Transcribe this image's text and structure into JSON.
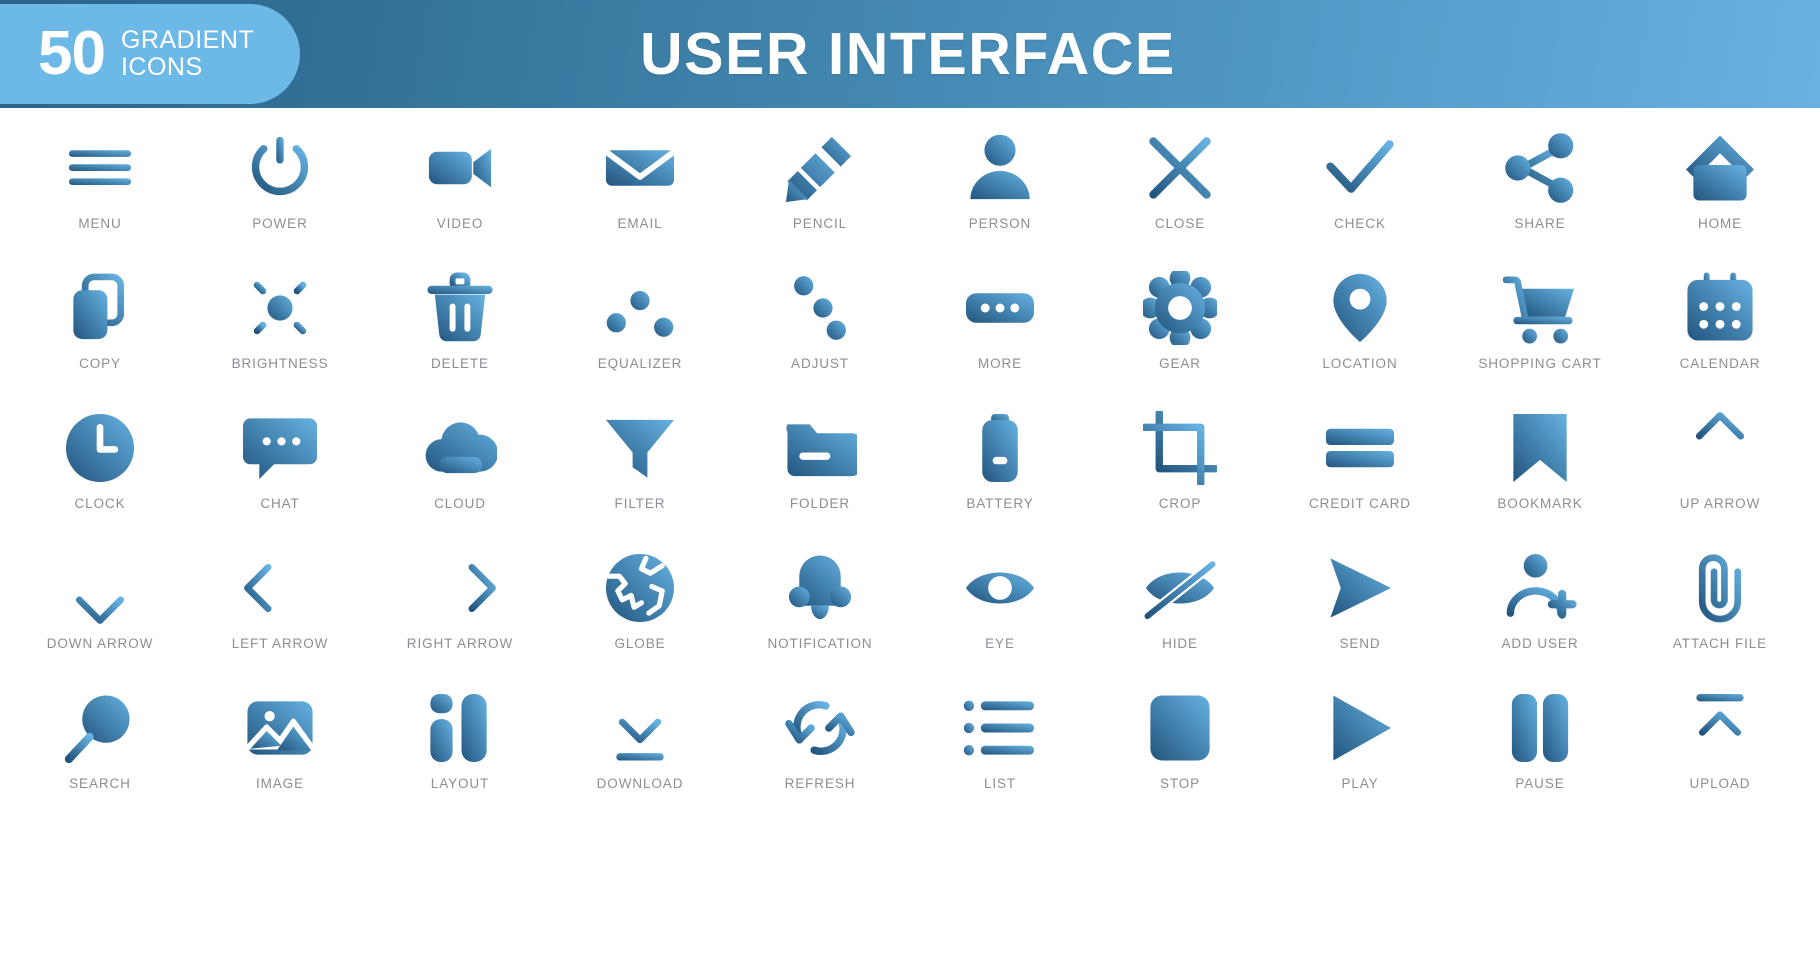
{
  "header": {
    "badge_number": "50",
    "badge_line1": "GRADIENT",
    "badge_line2": "ICONS",
    "title": "USER INTERFACE",
    "badge_color": "#6cb9e8",
    "gradient_start": "#2d6489",
    "gradient_end": "#68b2e0",
    "title_color": "#ffffff"
  },
  "style": {
    "icon_gradient_dark": "#22557e",
    "icon_gradient_light": "#66b2e2",
    "label_color": "#8b8e93",
    "background": "#ffffff"
  },
  "icons": [
    {
      "name": "menu",
      "label": "MENU"
    },
    {
      "name": "power",
      "label": "POWER"
    },
    {
      "name": "video",
      "label": "VIDEO"
    },
    {
      "name": "email",
      "label": "EMAIL"
    },
    {
      "name": "pencil",
      "label": "PENCIL"
    },
    {
      "name": "person",
      "label": "PERSON"
    },
    {
      "name": "close",
      "label": "CLOSE"
    },
    {
      "name": "check",
      "label": "CHECK"
    },
    {
      "name": "share",
      "label": "SHARE"
    },
    {
      "name": "home",
      "label": "HOME"
    },
    {
      "name": "copy",
      "label": "COPY"
    },
    {
      "name": "brightness",
      "label": "BRIGHTNESS"
    },
    {
      "name": "delete",
      "label": "DELETE"
    },
    {
      "name": "equalizer",
      "label": "EQUALIZER"
    },
    {
      "name": "adjust",
      "label": "ADJUST"
    },
    {
      "name": "more",
      "label": "MORE"
    },
    {
      "name": "gear",
      "label": "GEAR"
    },
    {
      "name": "location",
      "label": "LOCATION"
    },
    {
      "name": "shopping-cart",
      "label": "SHOPPING CART"
    },
    {
      "name": "calendar",
      "label": "CALENDAR"
    },
    {
      "name": "clock",
      "label": "CLOCK"
    },
    {
      "name": "chat",
      "label": "CHAT"
    },
    {
      "name": "cloud",
      "label": "CLOUD"
    },
    {
      "name": "filter",
      "label": "FILTER"
    },
    {
      "name": "folder",
      "label": "FOLDER"
    },
    {
      "name": "battery",
      "label": "BATTERY"
    },
    {
      "name": "crop",
      "label": "CROP"
    },
    {
      "name": "credit-card",
      "label": "CREDIT CARD"
    },
    {
      "name": "bookmark",
      "label": "BOOKMARK"
    },
    {
      "name": "up-arrow",
      "label": "UP ARROW"
    },
    {
      "name": "down-arrow",
      "label": "DOWN ARROW"
    },
    {
      "name": "left-arrow",
      "label": "LEFT ARROW"
    },
    {
      "name": "right-arrow",
      "label": "RIGHT ARROW"
    },
    {
      "name": "globe",
      "label": "GLOBE"
    },
    {
      "name": "notification",
      "label": "NOTIFICATION"
    },
    {
      "name": "eye",
      "label": "EYE"
    },
    {
      "name": "hide",
      "label": "HIDE"
    },
    {
      "name": "send",
      "label": "SEND"
    },
    {
      "name": "add-user",
      "label": "ADD USER"
    },
    {
      "name": "attach-file",
      "label": "ATTACH FILE"
    },
    {
      "name": "search",
      "label": "SEARCH"
    },
    {
      "name": "image",
      "label": "IMAGE"
    },
    {
      "name": "layout",
      "label": "LAYOUT"
    },
    {
      "name": "download",
      "label": "DOWNLOAD"
    },
    {
      "name": "refresh",
      "label": "REFRESH"
    },
    {
      "name": "list",
      "label": "LIST"
    },
    {
      "name": "stop",
      "label": "STOP"
    },
    {
      "name": "play",
      "label": "PLAY"
    },
    {
      "name": "pause",
      "label": "PAUSE"
    },
    {
      "name": "upload",
      "label": "UPLOAD"
    }
  ]
}
